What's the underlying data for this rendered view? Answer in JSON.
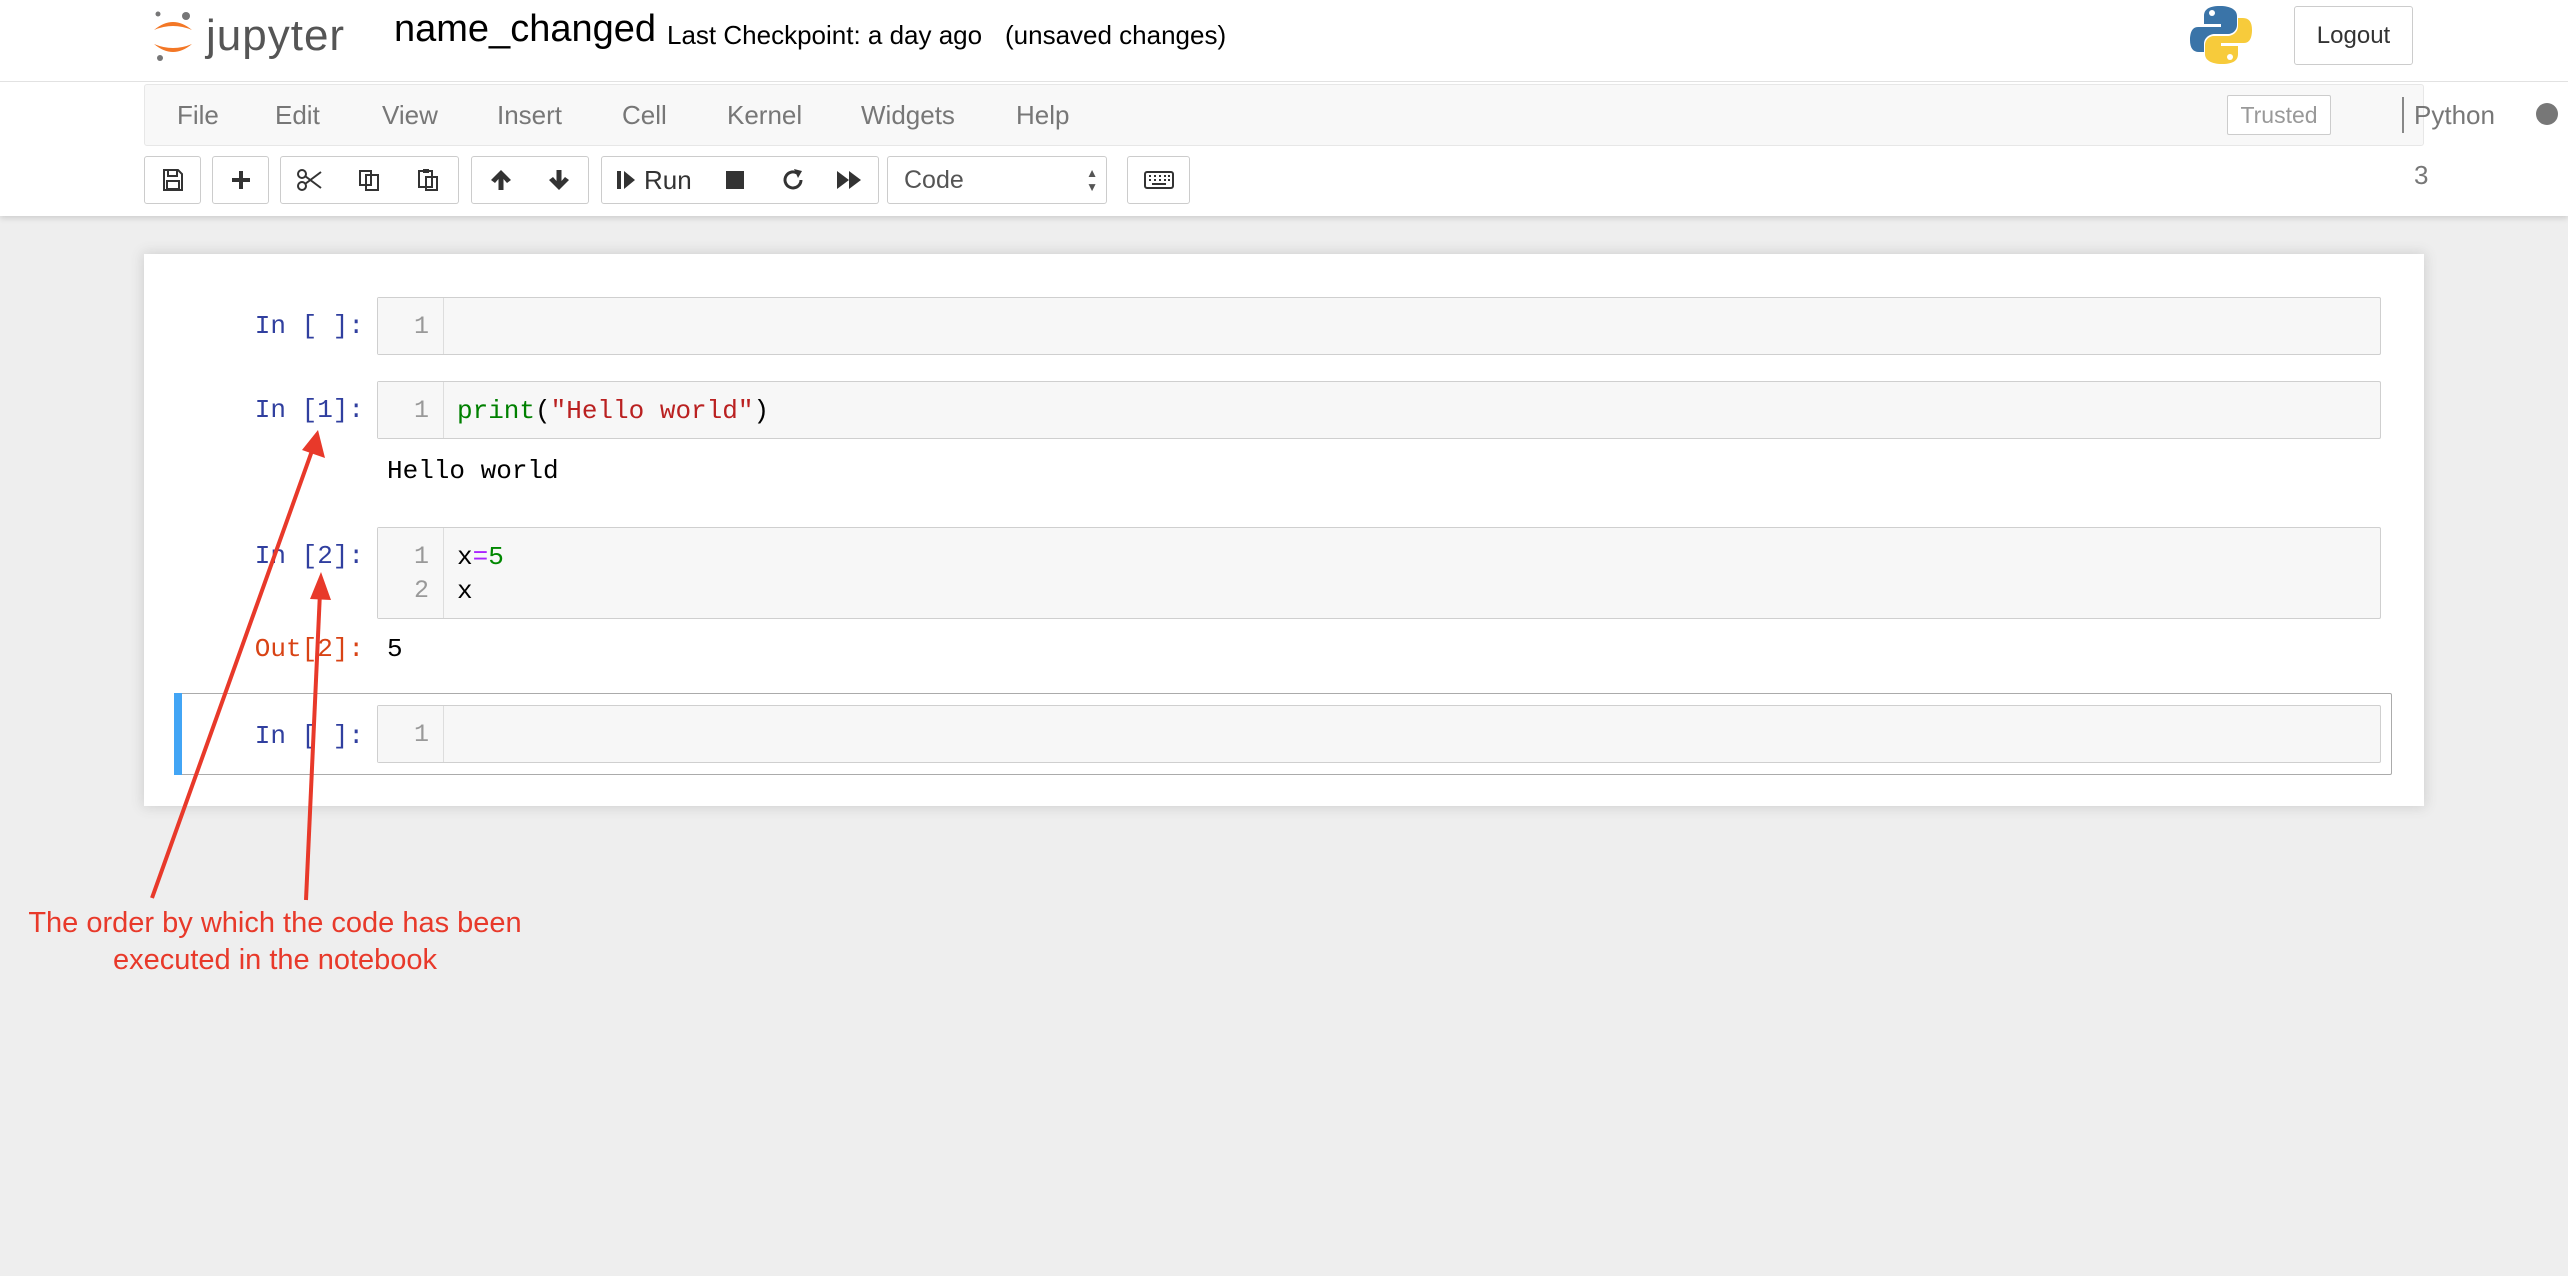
{
  "header": {
    "logo_text": "jupyter",
    "notebook_name": "name_changed",
    "checkpoint": "Last Checkpoint: a day ago",
    "unsaved": "(unsaved changes)",
    "logout_label": "Logout"
  },
  "menubar": {
    "items": [
      "File",
      "Edit",
      "View",
      "Insert",
      "Cell",
      "Kernel",
      "Widgets",
      "Help"
    ],
    "trusted_label": "Trusted",
    "kernel_name": "Python 3"
  },
  "toolbar": {
    "run_label": "Run",
    "cell_type": "Code"
  },
  "cells": [
    {
      "prompt": "In [ ]:",
      "lines": [
        ""
      ],
      "line_numbers": [
        "1"
      ]
    },
    {
      "prompt": "In [1]:",
      "code_print": "print",
      "code_open": "(",
      "code_string": "\"Hello world\"",
      "code_close": ")",
      "line_numbers": [
        "1"
      ],
      "output": "Hello world"
    },
    {
      "prompt": "In [2]:",
      "code_var": "x",
      "code_op": "=",
      "code_num": "5",
      "code_line2": "x",
      "line_numbers": [
        "1",
        "2"
      ],
      "out_prompt": "Out[2]:",
      "output": "5"
    },
    {
      "prompt": "In [ ]:",
      "line_numbers": [
        "1"
      ]
    }
  ],
  "annotation": {
    "line1": "The order by which the code has been",
    "line2": "executed in the notebook",
    "color": "#e8392a"
  },
  "colors": {
    "prompt_in": "#303f9f",
    "prompt_out": "#d84315",
    "selected_bar": "#42a5f5",
    "jupyter_orange": "#f37726"
  }
}
